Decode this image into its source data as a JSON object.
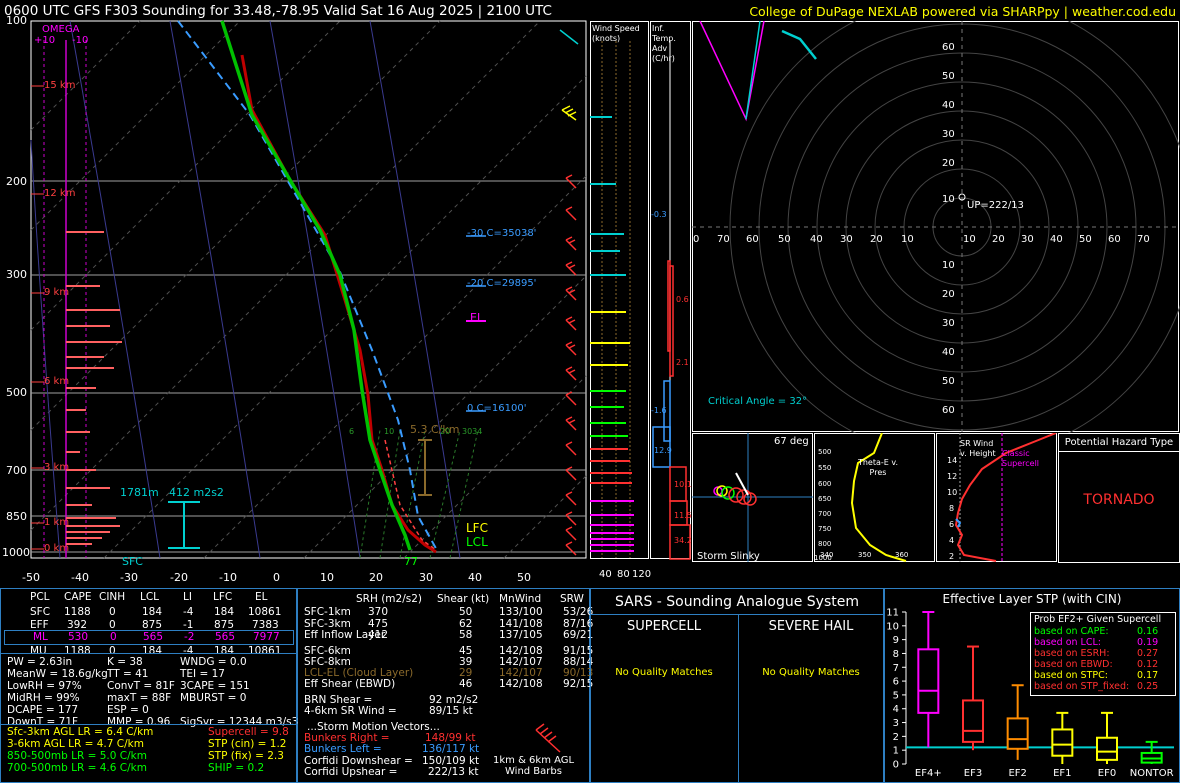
{
  "header": {
    "title": "0600 UTC GFS F303 Sounding for 33.48,-78.95 Valid  Sat 16 Aug 2025 | 2100 UTC",
    "credit": "College of DuPage NEXLAB powered via SHARPpy | weather.cod.edu"
  },
  "skewt": {
    "pressure_ticks": [
      "100",
      "200",
      "300",
      "500",
      "700",
      "850",
      "1000"
    ],
    "temp_ticks": [
      "-50",
      "-40",
      "-30",
      "-20",
      "-10",
      "0",
      "10",
      "20",
      "30",
      "40",
      "50"
    ],
    "omega_label": "OMEGA",
    "omega_scale": [
      "+10",
      "-10"
    ],
    "height_labels": [
      "15 km",
      "12 km",
      "9 km",
      "6 km",
      "3 km",
      "1 km",
      "0 km"
    ],
    "freezing_levels": [
      "-30 C=35038'",
      "-20 C=29895'",
      "0 C=16100'"
    ],
    "el_label": "EL",
    "lfc_label": "LFC",
    "lcl_label": "LCL",
    "lapse_label": "5.3 C/km",
    "effective_inflow_depth": "1781m",
    "effective_srh": "412 m2s2",
    "sfc_label": "SFC",
    "surface_temp": "77",
    "mixing_ratio_labels": [
      "6",
      "10",
      "20",
      "3034"
    ]
  },
  "wind_speed_panel": {
    "title": "Wind Speed (knots)",
    "ticks": [
      "40",
      "80",
      "120"
    ]
  },
  "inferred_temp_panel": {
    "title": "Inf. Temp. Adv (C/hr)",
    "values": [
      "-0.3",
      "0.6",
      "2.1",
      "-1.6",
      "12.9",
      "10.1",
      "11.5",
      "34.2"
    ]
  },
  "hodograph": {
    "upper_ticks": [
      "60",
      "50",
      "40",
      "30",
      "20",
      "10"
    ],
    "lower_ticks": [
      "10",
      "20",
      "30",
      "40",
      "50",
      "60"
    ],
    "x_ticks": [
      "0",
      "70",
      "60",
      "50",
      "40",
      "30",
      "20",
      "10",
      "10",
      "20",
      "30",
      "40",
      "50",
      "60",
      "70"
    ],
    "up_label": "UP=222/13",
    "critical_angle": "Critical Angle = 32°"
  },
  "storm_slinky": {
    "title": "Storm Slinky",
    "angle": "67 deg"
  },
  "theta_panel": {
    "title": "Theta-E v. Pres",
    "y_ticks": [
      "500",
      "550",
      "600",
      "650",
      "700",
      "750",
      "800",
      "850",
      "900",
      "950",
      "1000"
    ],
    "x_ticks": [
      "340",
      "350",
      "360"
    ]
  },
  "srwind_panel": {
    "title": "SR Wind v. Height",
    "subtitle": "Classic Supercell",
    "y_ticks": [
      "14",
      "12",
      "10",
      "8",
      "6",
      "4",
      "2"
    ]
  },
  "hazard": {
    "title": "Potential Hazard Type",
    "value": "TORNADO"
  },
  "parcel_table": {
    "headers": [
      "PCL",
      "CAPE",
      "CINH",
      "LCL",
      "LI",
      "LFC",
      "EL"
    ],
    "rows": [
      [
        "SFC",
        "1188",
        "0",
        "184",
        "-4",
        "184",
        "10861"
      ],
      [
        "EFF",
        "392",
        "0",
        "875",
        "-1",
        "875",
        "7383"
      ],
      [
        "ML",
        "530",
        "0",
        "565",
        "-2",
        "565",
        "7977"
      ],
      [
        "MU",
        "1188",
        "0",
        "184",
        "-4",
        "184",
        "10861"
      ]
    ]
  },
  "thermo_params": [
    [
      "PW = 2.63in",
      "K = 38",
      "WNDG = 0.0"
    ],
    [
      "MeanW = 18.6g/kg",
      "TT = 41",
      "TEI = 17"
    ],
    [
      "LowRH = 97%",
      "ConvT = 81F",
      "3CAPE = 151"
    ],
    [
      "MidRH = 99%",
      "maxT = 88F",
      "MBURST = 0"
    ],
    [
      "DCAPE = 177",
      "ESP = 0",
      ""
    ],
    [
      "DownT = 71F",
      "MMP = 0.96",
      "SigSvr = 12344 m3/s3"
    ]
  ],
  "lapse_rates": [
    {
      "left": "Sfc-3km AGL LR = 6.4 C/km",
      "right": "Supercell = 9.8"
    },
    {
      "left": "3-6km AGL LR = 4.7 C/km",
      "right": "STP (cin) = 1.2"
    },
    {
      "left": "850-500mb LR = 5.0 C/km",
      "right": "STP (fix) = 2.3"
    },
    {
      "left": "700-500mb LR = 4.6 C/km",
      "right": "SHIP = 0.2"
    }
  ],
  "kinematic_table": {
    "headers": [
      "SRH (m2/s2)",
      "Shear (kt)",
      "MnWind",
      "SRW"
    ],
    "rows_a": [
      [
        "SFC-1km",
        "370",
        "50",
        "133/100",
        "53/26"
      ],
      [
        "SFC-3km",
        "475",
        "62",
        "141/108",
        "87/16"
      ],
      [
        "Eff Inflow Layer",
        "412",
        "58",
        "137/105",
        "69/21"
      ]
    ],
    "rows_b": [
      [
        "SFC-6km",
        "",
        "45",
        "142/108",
        "91/15"
      ],
      [
        "SFC-8km",
        "",
        "39",
        "142/107",
        "88/14"
      ],
      [
        "LCL-EL (Cloud Layer)",
        "",
        "29",
        "142/107",
        "90/13"
      ],
      [
        "Eff Shear (EBWD)",
        "",
        "46",
        "142/108",
        "92/15"
      ]
    ],
    "brn_shear": "BRN Shear =",
    "brn_shear_val": "92 m2/s2",
    "sr_wind": "4-6km SR Wind =",
    "sr_wind_val": "89/15 kt",
    "storm_motion_title": "...Storm Motion Vectors...",
    "bunkers_right": "Bunkers Right =",
    "bunkers_right_val": "148/99 kt",
    "bunkers_left": "Bunkers Left =",
    "bunkers_left_val": "136/117 kt",
    "corfidi_down": "Corfidi Downshear =",
    "corfidi_down_val": "150/109 kt",
    "corfidi_up": "Corfidi Upshear =",
    "corfidi_up_val": "222/13 kt",
    "barbs_caption_1": "1km & 6km AGL",
    "barbs_caption_2": "Wind Barbs"
  },
  "sars": {
    "title": "SARS - Sounding Analogue System",
    "supercell_title": "SUPERCELL",
    "hail_title": "SEVERE HAIL",
    "supercell_result": "No Quality Matches",
    "hail_result": "No Quality Matches"
  },
  "stp_panel": {
    "title": "Effective Layer STP (with CIN)",
    "legend_title": "Prob EF2+ Given Supercell",
    "legend": [
      {
        "label": "based on CAPE:",
        "value": "0.16",
        "color": "#00ff00"
      },
      {
        "label": "based on LCL:",
        "value": "0.19",
        "color": "#ff00ff"
      },
      {
        "label": "based on ESRH:",
        "value": "0.27",
        "color": "#ff3030"
      },
      {
        "label": "based on EBWD:",
        "value": "0.12",
        "color": "#ff3030"
      },
      {
        "label": "based on STPC:",
        "value": "0.17",
        "color": "#ffff00"
      },
      {
        "label": "based on STP_fixed:",
        "value": "0.25",
        "color": "#ff3030"
      }
    ]
  },
  "chart_data": {
    "type": "box",
    "title": "Effective Layer STP (with CIN)",
    "categories": [
      "EF4+",
      "EF3",
      "EF2",
      "EF1",
      "EF0",
      "NONTOR"
    ],
    "y_ticks": [
      "0",
      "1",
      "2",
      "3",
      "4",
      "5",
      "6",
      "7",
      "8",
      "9",
      "10",
      "11"
    ],
    "ylim": [
      0,
      11
    ],
    "boxes": [
      {
        "name": "EF4+",
        "whisker_low": 1.2,
        "q1": 3.7,
        "median": 5.3,
        "q3": 8.3,
        "whisker_high": 11.0,
        "color": "#ff00ff"
      },
      {
        "name": "EF3",
        "whisker_low": 1.0,
        "q1": 1.6,
        "median": 2.4,
        "q3": 4.6,
        "whisker_high": 8.5,
        "color": "#ff3030"
      },
      {
        "name": "EF2",
        "whisker_low": 0.3,
        "q1": 1.1,
        "median": 1.8,
        "q3": 3.3,
        "whisker_high": 5.7,
        "color": "#ff8c00"
      },
      {
        "name": "EF1",
        "whisker_low": 0.0,
        "q1": 0.6,
        "median": 1.4,
        "q3": 2.5,
        "whisker_high": 3.7,
        "color": "#ffff00"
      },
      {
        "name": "EF0",
        "whisker_low": 0.0,
        "q1": 0.3,
        "median": 0.9,
        "q3": 1.9,
        "whisker_high": 3.7,
        "color": "#ffff00"
      },
      {
        "name": "NONTOR",
        "whisker_low": 0.0,
        "q1": 0.1,
        "median": 0.4,
        "q3": 0.8,
        "whisker_high": 1.6,
        "color": "#00ff00"
      }
    ],
    "current_value": 1.2
  }
}
